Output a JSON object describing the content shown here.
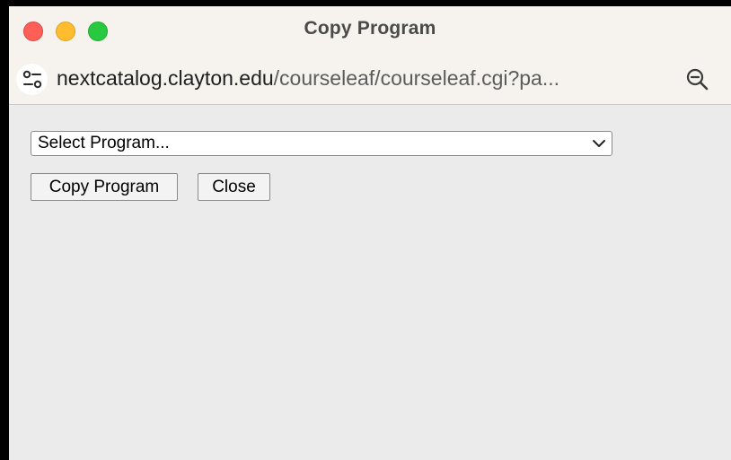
{
  "window": {
    "title": "Copy Program"
  },
  "urlbar": {
    "domain": "nextcatalog.clayton.edu",
    "path": "/courseleaf/courseleaf.cgi?pa...",
    "left_icon": "site-settings-icon",
    "right_icon": "zoom-icon"
  },
  "form": {
    "select_value": "Select Program...",
    "copy_button_label": "Copy Program",
    "close_button_label": "Close"
  },
  "colors": {
    "close_dot": "#fe5f57",
    "minimize_dot": "#febc2e",
    "maximize_dot": "#28c840",
    "content_bg": "#ebebeb",
    "chrome_bg": "#f6f3ee"
  }
}
